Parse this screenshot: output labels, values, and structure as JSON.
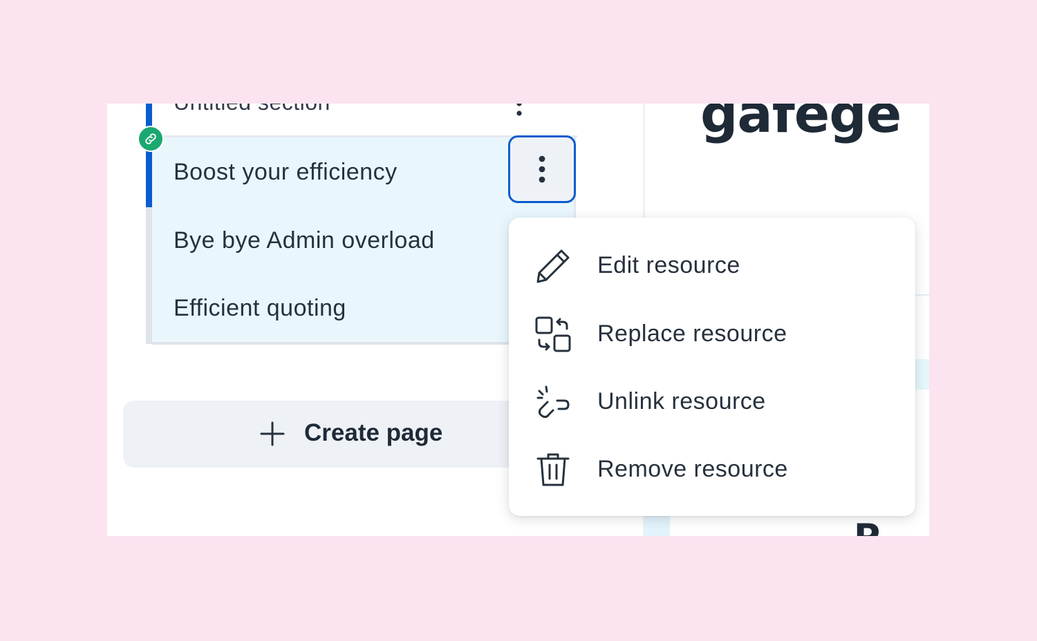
{
  "outline": {
    "partial_section_label": "Untitled section",
    "items": [
      {
        "label": "Boost your efficiency"
      },
      {
        "label": "Bye bye Admin overload"
      },
      {
        "label": "Efficient quoting"
      }
    ],
    "create_page_label": "Create page"
  },
  "preview": {
    "heading_fragment": "gafege",
    "partial_letter": "P"
  },
  "context_menu": {
    "items": [
      {
        "label": "Edit resource",
        "icon": "pencil-icon"
      },
      {
        "label": "Replace resource",
        "icon": "replace-icon"
      },
      {
        "label": "Unlink resource",
        "icon": "unlink-icon"
      },
      {
        "label": "Remove resource",
        "icon": "trash-icon"
      }
    ]
  },
  "colors": {
    "background": "#fbe3f0",
    "accent_blue": "#0b5ccf",
    "link_badge_green": "#1aa871",
    "selected_group_bg": "#e9f7fd",
    "text_dark": "#26313d"
  }
}
